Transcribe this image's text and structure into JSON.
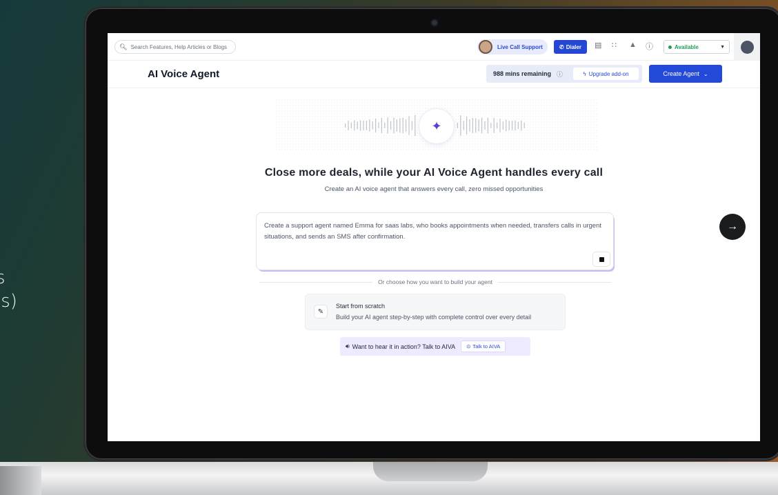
{
  "background": {
    "text_lines": [
      "s",
      "ls)"
    ]
  },
  "topbar": {
    "search_placeholder": "Search Features, Help Articles or Blogs",
    "live_call_support": "Live Call Support",
    "dialer": "Dialer",
    "status": "Available"
  },
  "header": {
    "title": "AI Voice Agent",
    "mins_remaining": "988 mins remaining",
    "upgrade": "Upgrade add-on",
    "create_agent": "Create Agent"
  },
  "main": {
    "headline": "Close more deals, while your AI Voice Agent handles every call",
    "subheadline": "Create an AI voice agent that answers every call, zero missed opportunities",
    "prompt_text": "Create a support agent named Emma for saas labs, who books appointments when needed, transfers calls in urgent situations, and sends an SMS after confirmation.",
    "divider_text": "Or choose how you want to build your agent",
    "scratch_title": "Start from scratch",
    "scratch_desc": "Build your AI agent step-by-step with complete control over every detail",
    "aiva_prompt": "Want to hear it in action? Talk to AIVA",
    "aiva_button": "Talk to AIVA"
  },
  "colors": {
    "accent": "#2349d9",
    "aiva_bg": "#eeeaff",
    "status_green": "#1f9d55"
  }
}
